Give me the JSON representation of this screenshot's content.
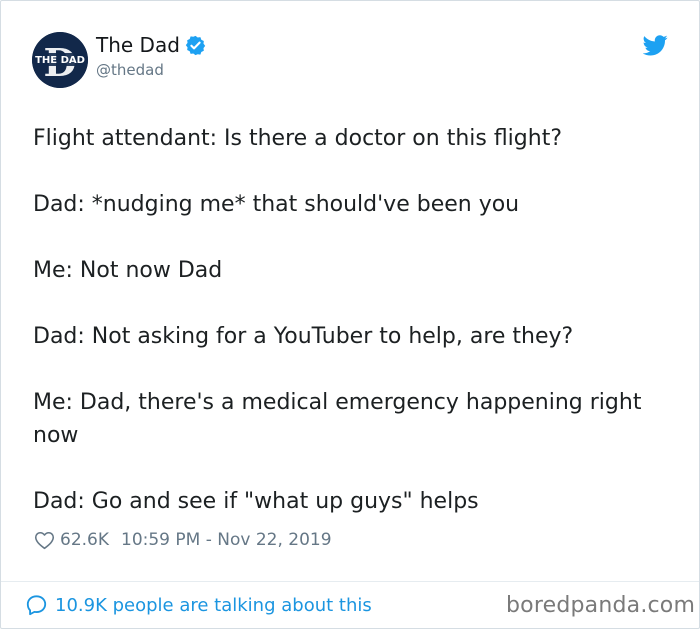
{
  "author": {
    "display_name": "The Dad",
    "handle": "@thedad",
    "avatar_text": "THE DAD",
    "avatar_letter": "D"
  },
  "tweet": {
    "lines": [
      "Flight attendant: Is there a doctor on this flight?",
      "Dad: *nudging me* that should've been you",
      "Me: Not now Dad",
      "Dad: Not asking for a YouTuber to help, are they?",
      "Me: Dad, there's a medical emergency happening right now",
      "Dad: Go and see if \"what up guys\" helps"
    ]
  },
  "meta": {
    "likes": "62.6K",
    "timestamp": "10:59 PM - Nov 22, 2019"
  },
  "footer": {
    "talking": "10.9K people are talking about this",
    "watermark": "boredpanda.com"
  },
  "icons": {
    "verified": "verified-badge-icon",
    "twitter": "twitter-bird-icon",
    "heart": "heart-icon",
    "comment": "comment-bubble-icon"
  },
  "colors": {
    "twitter_blue": "#1da1f2",
    "link_blue": "#1b95e0",
    "muted": "#657786",
    "avatar_navy": "#12284a"
  }
}
